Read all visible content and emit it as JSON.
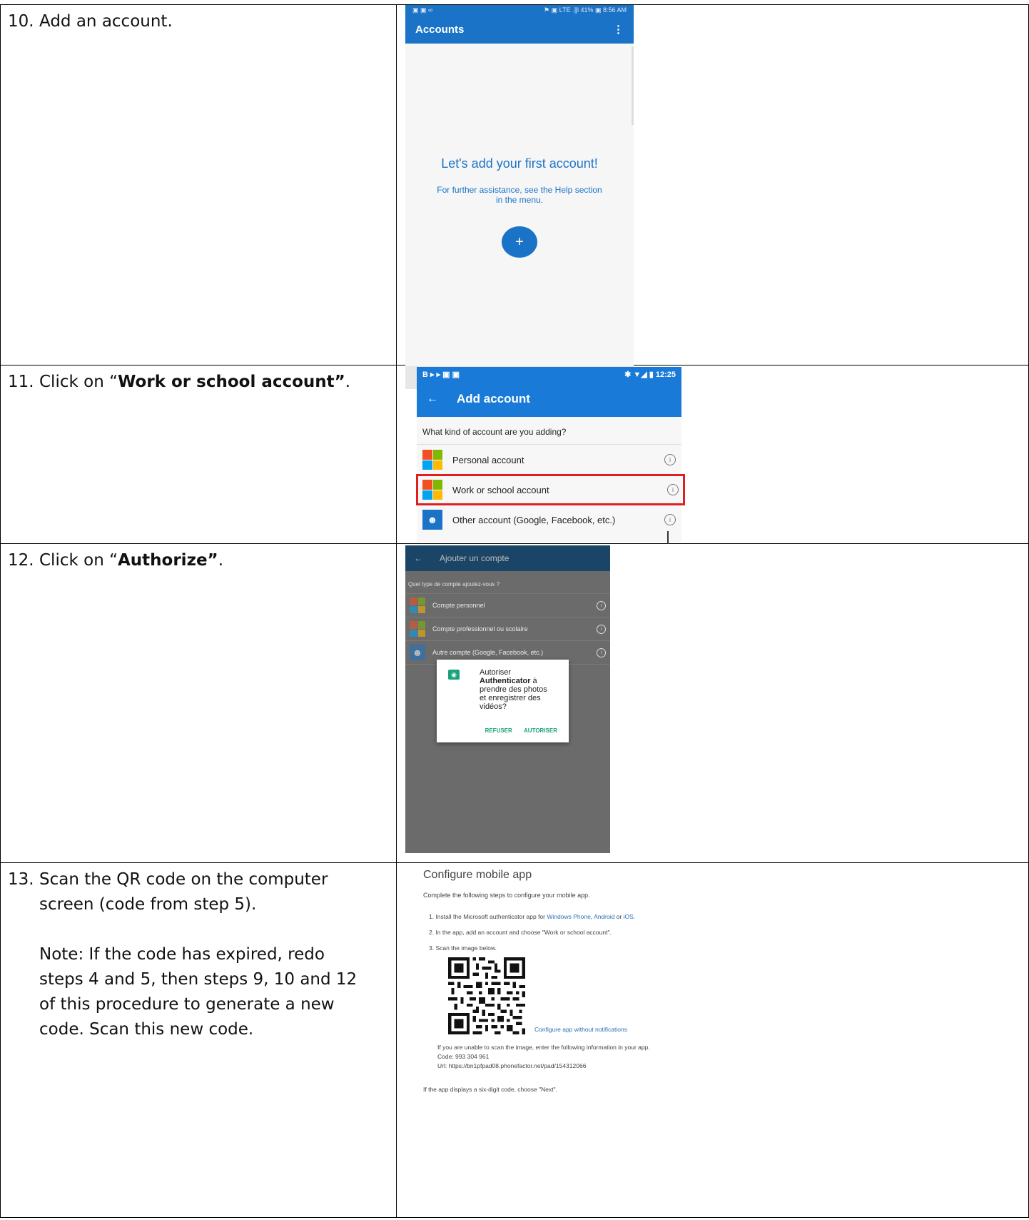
{
  "steps": [
    {
      "num": "10.",
      "text": "Add an account."
    },
    {
      "num": "11.",
      "pre": "Click on “",
      "bold": "Work or school account”",
      "post": "."
    },
    {
      "num": "12.",
      "pre": "Click on “",
      "bold": "Authorize”",
      "post": "."
    },
    {
      "num": "13.",
      "line1": "Scan the QR code on the computer",
      "line2": "screen (code from step 5).",
      "note": [
        "Note: If the code has expired, redo",
        "steps 4 and 5, then steps 9, 10 and 12",
        "of this procedure to generate a new",
        "code. Scan this new code."
      ]
    }
  ],
  "shot10": {
    "status_left": "▣ ▣ ∞",
    "status_right": "⚑ ▣ LTE .∥l 41% ▣ 8:56 AM",
    "title": "Accounts",
    "menu": "⋮",
    "hero": "Let's add your first account!",
    "help": "For further assistance, see the Help section in the menu.",
    "fab": "+",
    "nav": [
      "•",
      "⇄",
      "□",
      "←"
    ]
  },
  "shot11": {
    "status_left": "B ▸ ▸ ▣ ▣",
    "status_right": "✱ ▼◢ ▮ 12:25",
    "back": "←",
    "title": "Add account",
    "question": "What kind of account are you adding?",
    "rows": [
      "Personal account",
      "Work or school account",
      "Other account (Google, Facebook, etc.)"
    ],
    "info": "i"
  },
  "shot12": {
    "back": "←",
    "title": "Ajouter un compte",
    "question": "Quel type de compte ajoutez-vous ?",
    "rows": [
      "Compte personnel",
      "Compte professionnel ou scolaire",
      "Autre compte (Google, Facebook, etc.)"
    ],
    "info": "i",
    "dialog": {
      "line1": "Autoriser",
      "app": "Authenticator",
      "after_app": " à",
      "line3": "prendre des photos",
      "line4": "et enregistrer des",
      "line5": "vidéos?",
      "refuse": "REFUSER",
      "authorize": "AUTORISER"
    }
  },
  "shot13": {
    "title": "Configure mobile app",
    "lead": "Complete the following steps to configure your mobile app.",
    "step1_pre": "1.  Install the Microsoft authenticator app for ",
    "step1_links": [
      "Windows Phone",
      "Android",
      "iOS"
    ],
    "step1_sep1": ", ",
    "step1_sep2": " or ",
    "step1_post": ".",
    "step2": "2.  In the app, add an account and choose \"Work or school account\".",
    "step3": "3.  Scan the image below.",
    "no_notifications": "Configure app without notifications",
    "unable": "If you are unable to scan the image, enter the following information in your app.",
    "code": "Code: 993 304 961",
    "url": "Url:   https://bn1pfpad08.phonefactor.net/pad/154312066",
    "six_digit": "If the app displays a six-digit code, choose \"Next\"."
  }
}
